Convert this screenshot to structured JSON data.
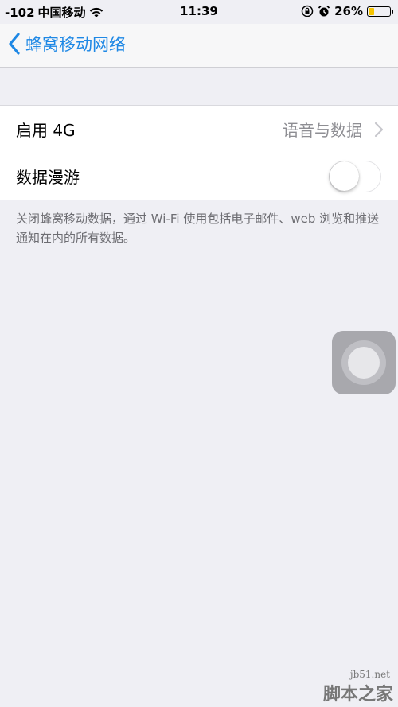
{
  "status_bar": {
    "signal": "-102",
    "carrier": "中国移动",
    "time": "11:39",
    "battery_percent": "26%",
    "battery_level": 0.26,
    "battery_color": "#f5c400"
  },
  "nav": {
    "back_icon": "chevron-left-icon",
    "title": "蜂窝移动网络",
    "accent_color": "#1e88e5"
  },
  "settings": {
    "enable_4g": {
      "label": "启用 4G",
      "value": "语音与数据"
    },
    "data_roaming": {
      "label": "数据漫游",
      "on": false
    }
  },
  "footer": {
    "text": "关闭蜂窝移动数据，通过 Wi-Fi 使用包括电子邮件、web 浏览和推送通知在内的所有数据。"
  },
  "watermark": {
    "line1": "jb51.net",
    "line2": "脚本之家"
  }
}
